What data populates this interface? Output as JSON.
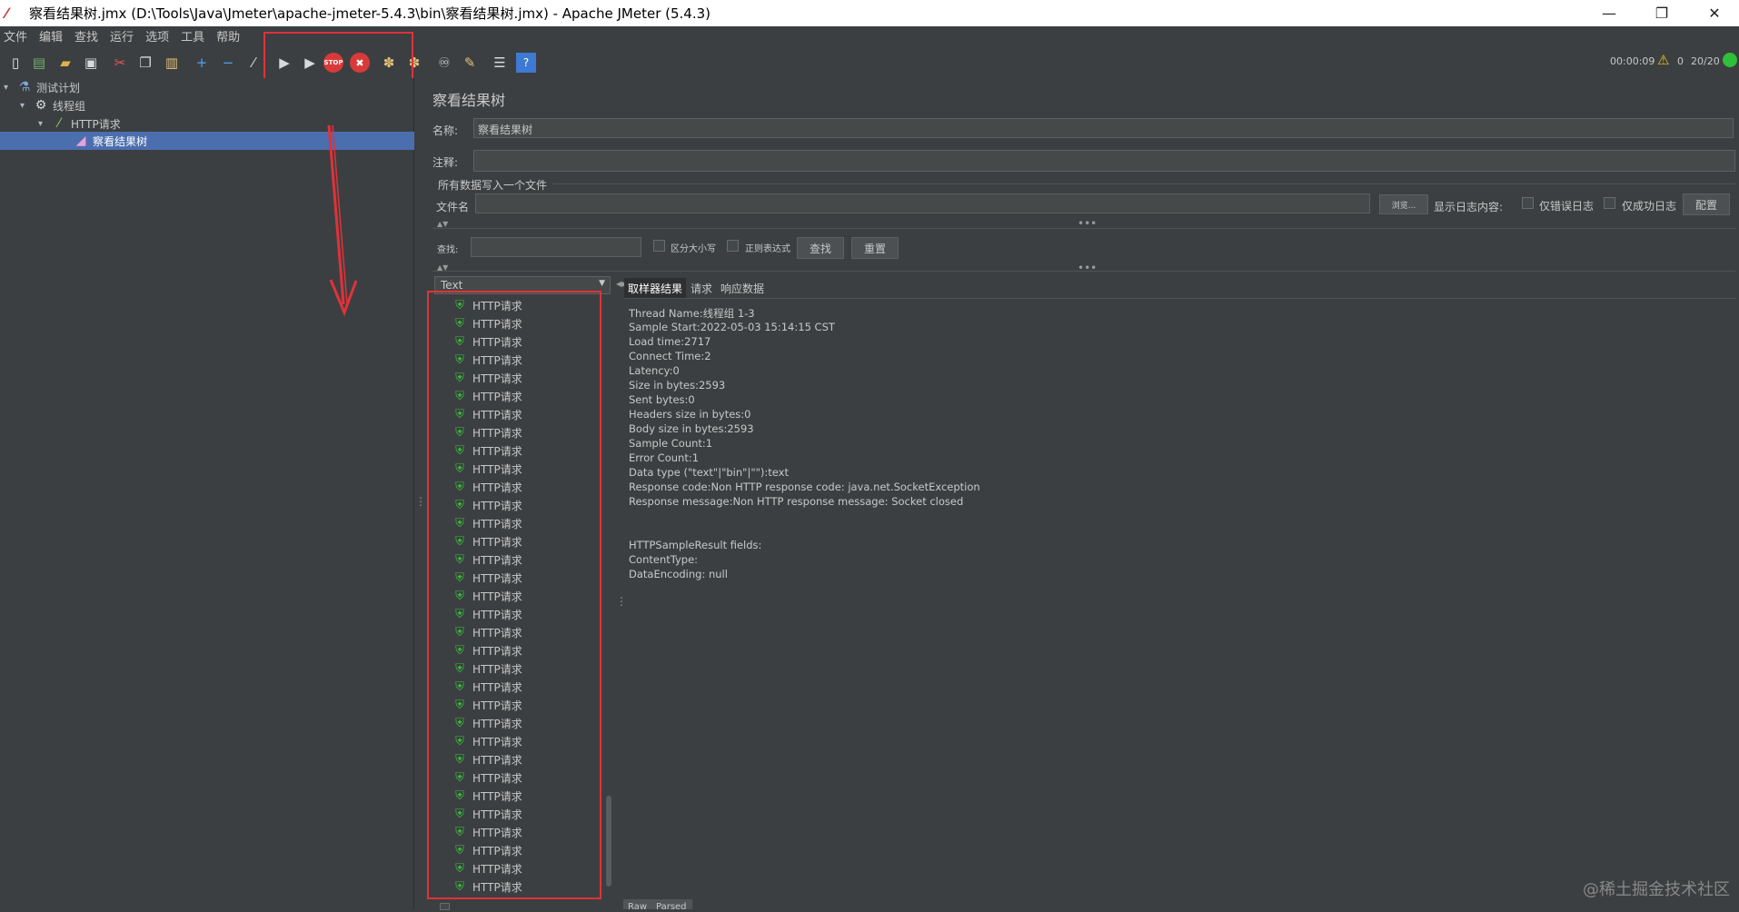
{
  "window": {
    "title": "察看结果树.jmx (D:\\Tools\\Java\\Jmeter\\apache-jmeter-5.4.3\\bin\\察看结果树.jmx) - Apache JMeter (5.4.3)",
    "minimize": "—",
    "restore": "❐",
    "close": "✕"
  },
  "menu": [
    "文件",
    "编辑",
    "查找",
    "运行",
    "选项",
    "工具",
    "帮助"
  ],
  "toolbar_status": {
    "elapsed": "00:00:09",
    "warnings": "0",
    "threads": "20/20"
  },
  "tree": {
    "test_plan": "测试计划",
    "thread_group": "线程组",
    "http_request": "HTTP请求",
    "view_results_tree": "察看结果树"
  },
  "panel": {
    "title": "察看结果树",
    "name_label": "名称:",
    "name_value": "察看结果树",
    "comment_label": "注释:",
    "comment_value": "",
    "write_all_label": "所有数据写入一个文件",
    "filename_label": "文件名",
    "filename_value": "",
    "browse_button": "浏览...",
    "log_display_label": "显示日志内容:",
    "errors_only": "仅错误日志",
    "success_only": "仅成功日志",
    "configure_button": "配置"
  },
  "search": {
    "label": "查找:",
    "value": "",
    "case_sensitive": "区分大小写",
    "regex": "正则表达式",
    "find_button": "查找",
    "reset_button": "重置"
  },
  "renderer": {
    "selected": "Text"
  },
  "results": {
    "item_label": "HTTP请求",
    "items": [
      "HTTP请求",
      "HTTP请求",
      "HTTP请求",
      "HTTP请求",
      "HTTP请求",
      "HTTP请求",
      "HTTP请求",
      "HTTP请求",
      "HTTP请求",
      "HTTP请求",
      "HTTP请求",
      "HTTP请求",
      "HTTP请求",
      "HTTP请求",
      "HTTP请求",
      "HTTP请求",
      "HTTP请求",
      "HTTP请求",
      "HTTP请求",
      "HTTP请求",
      "HTTP请求",
      "HTTP请求",
      "HTTP请求",
      "HTTP请求",
      "HTTP请求",
      "HTTP请求",
      "HTTP请求",
      "HTTP请求",
      "HTTP请求",
      "HTTP请求",
      "HTTP请求",
      "HTTP请求",
      "HTTP请求"
    ]
  },
  "detail_tabs": [
    "取样器结果",
    "请求",
    "响应数据"
  ],
  "sampler_result": [
    "Thread Name:线程组 1-3",
    "Sample Start:2022-05-03 15:14:15 CST",
    "Load time:2717",
    "Connect Time:2",
    "Latency:0",
    "Size in bytes:2593",
    "Sent bytes:0",
    "Headers size in bytes:0",
    "Body size in bytes:2593",
    "Sample Count:1",
    "Error Count:1",
    "Data type (\"text\"|\"bin\"|\"\"):text",
    "Response code:Non HTTP response code: java.net.SocketException",
    "Response message:Non HTTP response message: Socket closed",
    "",
    "",
    "HTTPSampleResult fields:",
    "ContentType: ",
    "DataEncoding: null"
  ],
  "bottom_tabs": [
    "Raw",
    "Parsed"
  ],
  "watermark": "@稀土掘金技术社区"
}
